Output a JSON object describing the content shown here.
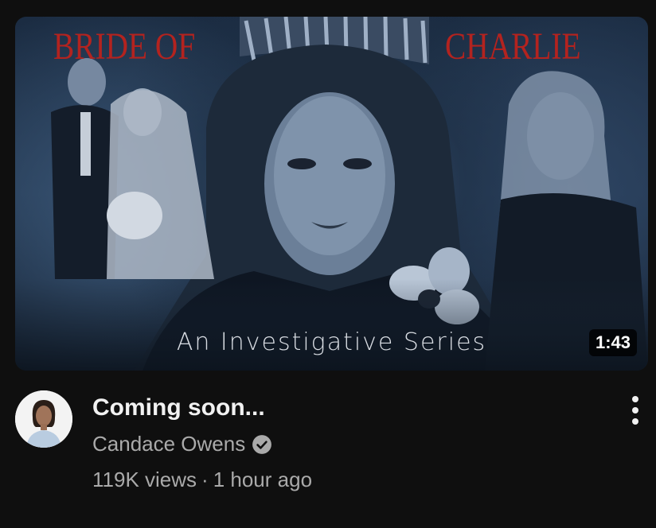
{
  "thumbnail": {
    "title_left": "BRIDE OF",
    "title_right": "CHARLIE",
    "subtitle": "An Investigative Series",
    "duration": "1:43",
    "title_color": "#b3231f"
  },
  "video": {
    "title": "Coming soon...",
    "channel": "Candace Owens",
    "views": "119K views",
    "separator": "·",
    "age": "1 hour ago"
  },
  "icons": {
    "verified": "verified-check-icon",
    "menu": "more-vert-icon"
  },
  "colors": {
    "background": "#0f0f0f",
    "title_text": "#f1f1f1",
    "secondary_text": "#aaaaaa"
  }
}
